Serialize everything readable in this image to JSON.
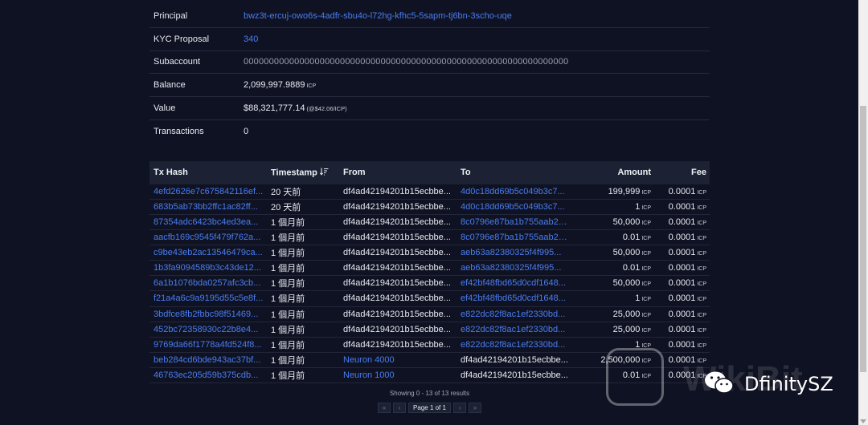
{
  "account": {
    "rows": [
      {
        "label": "Principal",
        "value": "bwz3t-ercuj-owo6s-4adfr-sbu4o-l72hg-kfhc5-5sapm-tj6bn-3scho-uqe",
        "link": true
      },
      {
        "label": "KYC Proposal",
        "value": "340",
        "link": true
      },
      {
        "label": "Subaccount",
        "value": "0000000000000000000000000000000000000000000000000000000000000000",
        "link": false
      },
      {
        "label": "Balance",
        "value": "2,099,997.9889",
        "unit": "ICP"
      },
      {
        "label": "Value",
        "value": "$88,321,777.14",
        "rate": "(@$42.06/ICP)"
      },
      {
        "label": "Transactions",
        "value": "0"
      }
    ]
  },
  "tx_table": {
    "headers": {
      "hash": "Tx Hash",
      "time": "Timestamp",
      "from": "From",
      "to": "To",
      "amount": "Amount",
      "fee": "Fee"
    },
    "unit": "ICP",
    "rows": [
      {
        "hash": "4efd2626e7c675842116ef...",
        "time": "20 天前",
        "from": "df4ad42194201b15ecbbe...",
        "to": "4d0c18dd69b5c049b3c7...",
        "to_link": true,
        "amount": "199,999",
        "fee": "0.0001"
      },
      {
        "hash": "683b5ab73bb2ffc1ac82ff...",
        "time": "20 天前",
        "from": "df4ad42194201b15ecbbe...",
        "to": "4d0c18dd69b5c049b3c7...",
        "to_link": true,
        "amount": "1",
        "fee": "0.0001"
      },
      {
        "hash": "87354adc6423bc4ed3ea...",
        "time": "1 個月前",
        "from": "df4ad42194201b15ecbbe...",
        "to": "8c0796e87ba1b755aab2d...",
        "to_link": true,
        "amount": "50,000",
        "fee": "0.0001"
      },
      {
        "hash": "aacfb169c9545f479f762a...",
        "time": "1 個月前",
        "from": "df4ad42194201b15ecbbe...",
        "to": "8c0796e87ba1b755aab2d...",
        "to_link": true,
        "amount": "0.01",
        "fee": "0.0001"
      },
      {
        "hash": "c9be43eb2ac13546479ca...",
        "time": "1 個月前",
        "from": "df4ad42194201b15ecbbe...",
        "to": "aeb63a82380325f4f995...",
        "to_link": true,
        "amount": "50,000",
        "fee": "0.0001"
      },
      {
        "hash": "1b3fa9094589b3c43de12...",
        "time": "1 個月前",
        "from": "df4ad42194201b15ecbbe...",
        "to": "aeb63a82380325f4f995...",
        "to_link": true,
        "amount": "0.01",
        "fee": "0.0001"
      },
      {
        "hash": "6a1b1076bda0257afc3cb...",
        "time": "1 個月前",
        "from": "df4ad42194201b15ecbbe...",
        "to": "ef42bf48fbd65d0cdf1648...",
        "to_link": true,
        "amount": "50,000",
        "fee": "0.0001"
      },
      {
        "hash": "f21a4a6c9a9195d55c5e8f...",
        "time": "1 個月前",
        "from": "df4ad42194201b15ecbbe...",
        "to": "ef42bf48fbd65d0cdf1648...",
        "to_link": true,
        "amount": "1",
        "fee": "0.0001"
      },
      {
        "hash": "3bdfce8fb2fbbc98f51469...",
        "time": "1 個月前",
        "from": "df4ad42194201b15ecbbe...",
        "to": "e822dc82f8ac1ef2330bd...",
        "to_link": true,
        "amount": "25,000",
        "fee": "0.0001"
      },
      {
        "hash": "452bc72358930c22b8e4...",
        "time": "1 個月前",
        "from": "df4ad42194201b15ecbbe...",
        "to": "e822dc82f8ac1ef2330bd...",
        "to_link": true,
        "amount": "25,000",
        "fee": "0.0001"
      },
      {
        "hash": "9769da66f1778a4fd524f8...",
        "time": "1 個月前",
        "from": "df4ad42194201b15ecbbe...",
        "to": "e822dc82f8ac1ef2330bd...",
        "to_link": true,
        "amount": "1",
        "fee": "0.0001"
      },
      {
        "hash": "beb284cd6bde943ac37bf...",
        "time": "1 個月前",
        "from": "Neuron 4000",
        "from_link": true,
        "to": "df4ad42194201b15ecbbe...",
        "to_link": false,
        "amount": "2,500,000",
        "fee": "0.0001"
      },
      {
        "hash": "46763ec205d59b375cdb...",
        "time": "1 個月前",
        "from": "Neuron 1000",
        "from_link": true,
        "to": "df4ad42194201b15ecbbe...",
        "to_link": false,
        "amount": "0.01",
        "fee": "0.0001"
      }
    ]
  },
  "pagination": {
    "showing": "Showing 0 - 13 of 13 results",
    "page_label": "Page 1 of 1",
    "first": "«",
    "prev": "‹",
    "next": "›",
    "last": "»"
  },
  "watermark": {
    "brand": "WikiBit",
    "account_name": "DfinitySZ"
  },
  "colors": {
    "background": "#0f1222",
    "link": "#4a7df0",
    "header_bg": "#1c2233"
  }
}
